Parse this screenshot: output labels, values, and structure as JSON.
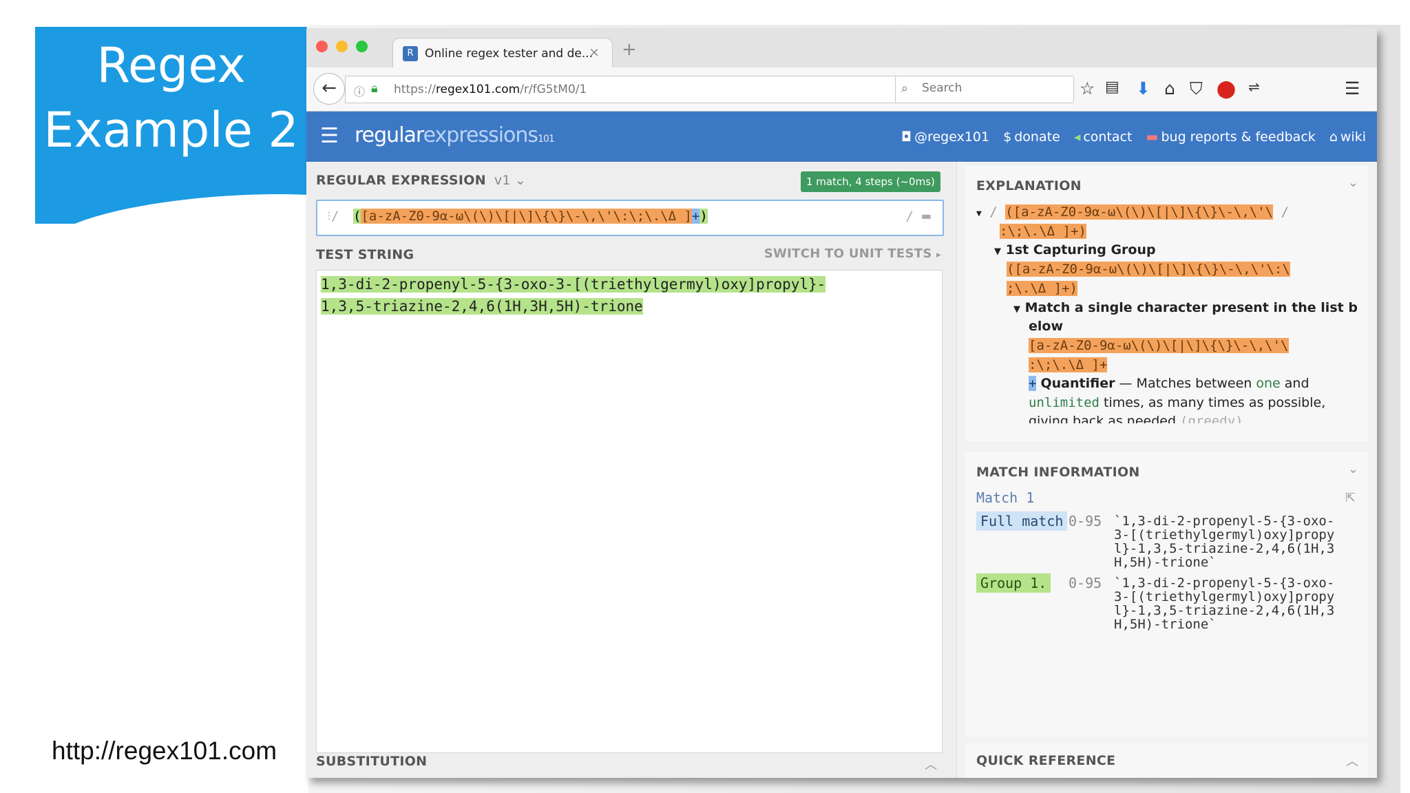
{
  "slide": {
    "title_line1": "Regex",
    "title_line2": "Example 2",
    "source": "http://regex101.com"
  },
  "browser": {
    "tab_title": "Online regex tester and de...",
    "tab_close": "×",
    "new_tab": "+",
    "url_prefix": "https://",
    "url_host": "regex101.com",
    "url_path": "/r/fG5tM0/1",
    "search_placeholder": "Search"
  },
  "site": {
    "brand_1": "regular",
    "brand_2": "expressions",
    "brand_3": "101",
    "links": {
      "twitter": "@regex101",
      "donate": "donate",
      "contact": "contact",
      "bugs": "bug reports & feedback",
      "wiki": "wiki"
    }
  },
  "regex_panel": {
    "label": "REGULAR EXPRESSION",
    "version": "v1",
    "status": "1 match, 4 steps (~0ms)",
    "delim_open": "/",
    "delim_close": "/",
    "rx_open": "(",
    "rx_class": "[a-zA-Z0-9α-ω\\(\\)\\[|\\]\\{\\}\\-\\,\\'\\:\\;\\.\\Δ ]",
    "rx_plus": "+",
    "rx_close": ")"
  },
  "test_panel": {
    "label": "TEST STRING",
    "switch_label": "SWITCH TO UNIT TESTS",
    "line1": "1,3-di-2-propenyl-5-{3-oxo-3-[(triethylgermyl)oxy]propyl}-",
    "line2": "1,3,5-triazine-2,4,6(1H,3H,5H)-trione"
  },
  "substitution": {
    "label": "SUBSTITUTION"
  },
  "explanation": {
    "label": "EXPLANATION",
    "l1_a": "([a-zA-Z0-9α-ω\\(\\)\\[|\\]\\{\\}\\-\\,\\'\\",
    "l1_b": ":\\;\\.\\Δ ]+)",
    "group_title": "1st Capturing Group",
    "l2_a": "([a-zA-Z0-9α-ω\\(\\)\\[|\\]\\{\\}\\-\\,\\'\\:\\",
    "l2_b": ";\\.\\Δ ]+)",
    "char_title_1": "Match a single character present in the list b",
    "char_title_2": "elow",
    "l3_a": "[a-zA-Z0-9α-ω\\(\\)\\[|\\]\\{\\}\\-\\,\\'\\",
    "l3_b": ":\\;\\.\\Δ ]+",
    "quant_word": "Quantifier",
    "quant_text": " — Matches between ",
    "quant_one": "one",
    "quant_and": " and",
    "quant_unlimited": "unlimited",
    "quant_rest": " times, as many times as possible,",
    "quant_last": "giving back as needed",
    "quant_greedy": "(greedy)"
  },
  "match_info": {
    "label": "MATCH INFORMATION",
    "match_title": "Match 1",
    "full_label": "Full match",
    "full_range": "0-95",
    "full_value": "`1,3-di-2-propenyl-5-{3-oxo-\n3-[(triethylgermyl)oxy]propy\nl}-1,3,5-triazine-2,4,6(1H,3\nH,5H)-trione`",
    "group_label": "Group 1.",
    "group_range": "0-95",
    "group_value": "`1,3-di-2-propenyl-5-{3-oxo-\n3-[(triethylgermyl)oxy]propy\nl}-1,3,5-triazine-2,4,6(1H,3\nH,5H)-trione`"
  },
  "quick_reference": {
    "label": "QUICK REFERENCE"
  },
  "icons": [
    "back-arrow-icon",
    "info-icon",
    "lock-icon",
    "reload-icon",
    "search-icon",
    "star-icon",
    "clipboard-icon",
    "download-icon",
    "home-icon",
    "pocket-icon",
    "adblock-icon",
    "menu-icon",
    "hamburger-icon"
  ],
  "colors": {
    "title_blue": "#1c9be3",
    "header_blue": "#3d78c5",
    "match_green": "#b4e38a",
    "token_orange": "#f4a25b",
    "token_blue": "#8dbaf0",
    "status_green": "#3e9a5e"
  }
}
